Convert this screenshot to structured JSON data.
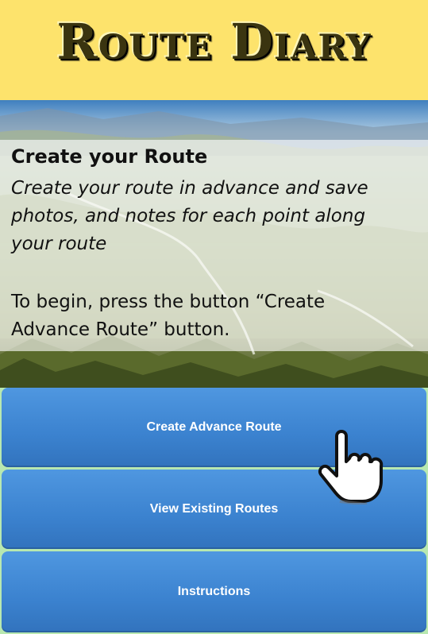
{
  "app": {
    "title": "Route Diary"
  },
  "intro": {
    "heading": "Create your Route",
    "description": "Create your route in advance and save photos, and notes for each point along your route",
    "instruction": "To begin, press the button “Create Advance Route” button."
  },
  "buttons": {
    "create_advance_route": "Create Advance Route",
    "view_existing_routes": "View Existing Routes",
    "instructions": "Instructions"
  },
  "colors": {
    "header_bg": "#fde36c",
    "button_bg": "#3b82cf",
    "separator": "#b8e8b0"
  },
  "icons": {
    "pointer": "pointing-hand-icon"
  }
}
